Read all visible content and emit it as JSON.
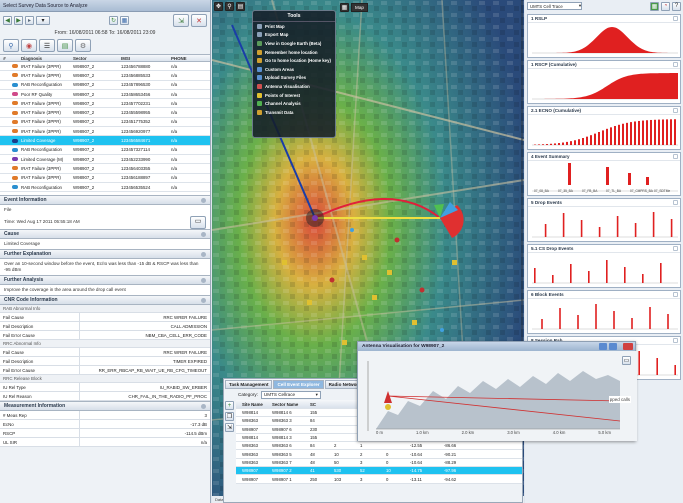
{
  "left_panel": {
    "title": "Select Survey Data Source to Analyze",
    "date_range": "From: 16/08/2011 06:58 To: 16/08/2011 23:09",
    "columns": [
      "#",
      "",
      "Diagnosis",
      "Sector",
      "IMSI",
      "PHONE"
    ],
    "rows": [
      {
        "n": "",
        "color": "#e07a2a",
        "diagnosis": "IRAT Failure (3PPR)",
        "sector": "W98907_2",
        "imsi": "123456788880",
        "phone": "n/a"
      },
      {
        "n": "",
        "color": "#e07a2a",
        "diagnosis": "IRAT Failure (3PPR)",
        "sector": "W98907_2",
        "imsi": "123456885533",
        "phone": "n/a"
      },
      {
        "n": "",
        "color": "#2a8fd0",
        "diagnosis": "RAB Reconfiguration",
        "sector": "W98907_2",
        "imsi": "123457896530",
        "phone": "n/a"
      },
      {
        "n": "",
        "color": "#d04a8a",
        "diagnosis": "Poor RF Quality",
        "sector": "W98907_2",
        "imsi": "123458653456",
        "phone": "n/a"
      },
      {
        "n": "",
        "color": "#e07a2a",
        "diagnosis": "IRAT Failure (3PPR)",
        "sector": "W98907_2",
        "imsi": "123457702231",
        "phone": "n/a"
      },
      {
        "n": "",
        "color": "#e07a2a",
        "diagnosis": "IRAT Failure (3PPR)",
        "sector": "W98907_2",
        "imsi": "123455598955",
        "phone": "n/a"
      },
      {
        "n": "",
        "color": "#e07a2a",
        "diagnosis": "IRAT Failure (3PPR)",
        "sector": "W98907_2",
        "imsi": "123451775352",
        "phone": "n/a"
      },
      {
        "n": "",
        "color": "#e07a2a",
        "diagnosis": "IRAT Failure (3PPR)",
        "sector": "W98907_2",
        "imsi": "123456920977",
        "phone": "n/a"
      },
      {
        "n": "",
        "color": "#1a3d8a",
        "diagnosis": "Limited Coverage",
        "sector": "W98907_2",
        "imsi": "123456584671",
        "phone": "n/a",
        "selected": true
      },
      {
        "n": "",
        "color": "#2a8fd0",
        "diagnosis": "RAB Reconfiguration",
        "sector": "W98907_2",
        "imsi": "123457327114",
        "phone": "n/a"
      },
      {
        "n": "",
        "color": "#7a3ab0",
        "diagnosis": "Limited Coverage (M)",
        "sector": "W98907_2",
        "imsi": "123452233990",
        "phone": "n/a"
      },
      {
        "n": "",
        "color": "#e07a2a",
        "diagnosis": "IRAT Failure (3PPR)",
        "sector": "W98907_2",
        "imsi": "123456403355",
        "phone": "n/a"
      },
      {
        "n": "",
        "color": "#e07a2a",
        "diagnosis": "IRAT Failure (3PPR)",
        "sector": "W98907_2",
        "imsi": "123456188897",
        "phone": "n/a"
      },
      {
        "n": "",
        "color": "#2a8fd0",
        "diagnosis": "RAB Reconfiguration",
        "sector": "W98907_2",
        "imsi": "123456535524",
        "phone": "n/a"
      }
    ],
    "event_info_header": "Event Information",
    "file_label": "File",
    "time_label": "Time: Wed Aug 17 2011 05:55:18 AM",
    "cause_header": "Cause",
    "cause_value": "Limited Coverage",
    "further_expl_header": "Further Explanation",
    "further_expl_text": "Over an 10-second window before the event, Ec/Io was less than -15 dB & RSCP was less than -95 dBm",
    "further_analysis_header": "Further Analysis",
    "further_analysis_text": "Improve the coverage in the area around the drop call event",
    "cnr_header": "CNR Code Information",
    "rab_header": "RAB Abnormal Info",
    "rab_rows": [
      {
        "k": "Fail Cause",
        "v": "RRC WRER FAILURE"
      },
      {
        "k": "Fail Description",
        "v": "CALL ADMISSION"
      },
      {
        "k": "Fail Error Cause",
        "v": "NBM_CBA_CELL_ERR_CODE"
      }
    ],
    "rrc_header": "RRC Abnormal Info",
    "rrc_rows": [
      {
        "k": "Fail Cause",
        "v": "RRC WRER FAILURE"
      },
      {
        "k": "Fail Description",
        "v": "TIMER EXPIRED"
      },
      {
        "k": "Fail Error Cause",
        "v": "RR_ERR_RBCAP_RB_WAIT_UE_RB_CFG_TIMEOUT"
      }
    ],
    "release_header": "RRC Release Block",
    "release_rows": [
      {
        "k": "IU Rel Type",
        "v": "IU_RABID_SW_ERBER"
      },
      {
        "k": "IU Rel Reason",
        "v": "CHR_FAIL_IN_THE_RADIO_PF_PROC"
      }
    ],
    "meas_header": "Measurement Information",
    "meas_rows": [
      {
        "k": "# Meas Rep",
        "v": "3"
      },
      {
        "k": "EcNo",
        "v": "-17.3 dB"
      },
      {
        "k": "RSCP",
        "v": "-114.5 dBm"
      },
      {
        "k": "UL SIR",
        "v": "n/a"
      }
    ]
  },
  "map": {
    "top_label": "Map",
    "tools_title": "Tools",
    "tools": [
      {
        "label": "Print Map",
        "color": "#8aa0b8"
      },
      {
        "label": "Export Map",
        "color": "#8aa0b8"
      },
      {
        "label": "View in Google Earth (Beta)",
        "color": "#5a9a5a"
      },
      {
        "label": "Remember home location",
        "color": "#d0a030"
      },
      {
        "label": "Go to home location (Home key)",
        "color": "#d0a030"
      },
      {
        "label": "Custom Areas",
        "color": "#5a90d0"
      },
      {
        "label": "Upload Survey Files",
        "color": "#5a90d0"
      },
      {
        "label": "Antenna Visualisation",
        "color": "#d05050"
      },
      {
        "label": "Points of Interest",
        "color": "#e0c030"
      },
      {
        "label": "Channel Analysis",
        "color": "#50b050"
      },
      {
        "label": "Transmit Data",
        "color": "#d0a030"
      }
    ],
    "status": "Data location: lat: 9.18147, lng: 263.09098 and lat: 9.14886, lng: 261.08845"
  },
  "right_panel": {
    "dropdown": "UMTS Cell Trace",
    "charts": [
      {
        "title": "1 RSLP"
      },
      {
        "title": "1 RSCP (Cumulative)"
      },
      {
        "title": "2.1 ECNO (Cumulative)"
      },
      {
        "title": "4 Event Summary"
      },
      {
        "title": "5 Drop Events"
      },
      {
        "title": "5.1 CS Drop Events"
      },
      {
        "title": "6 Block Events"
      },
      {
        "title": "8 Session Rab"
      }
    ],
    "event_summary_ticks": [
      "07_08_BA",
      "07_35_BA",
      "07_FB_BA",
      "07_TL_BA",
      "07_CMPRS_BA",
      "07_SDTMe"
    ]
  },
  "bottom_table": {
    "tabs": [
      "Task Management",
      "Cell Event Explorer",
      "Radio Network"
    ],
    "category_label": "Category:",
    "category_value": "UMTS Cellrace",
    "columns": [
      "",
      "Site Name",
      "Sector Name",
      "SC",
      "",
      "",
      "",
      "",
      ""
    ],
    "rows": [
      [
        "",
        "W98814",
        "W98814 6",
        "155",
        "",
        "",
        "",
        "",
        ""
      ],
      [
        "",
        "W98363",
        "W98363 3",
        "84",
        "",
        "",
        "",
        "",
        ""
      ],
      [
        "",
        "W98907",
        "W98907 6",
        "230",
        "",
        "",
        "",
        "",
        ""
      ],
      [
        "",
        "W98814",
        "W98814 3",
        "155",
        "",
        "",
        "",
        "",
        ""
      ],
      [
        "",
        "W98363",
        "W98363 6",
        "84",
        "2",
        "1",
        "",
        "-12.55",
        "-86.66"
      ],
      [
        "",
        "W98363",
        "W98363 5",
        "48",
        "10",
        "2",
        "0",
        "-10.64",
        "-90.21"
      ],
      [
        "",
        "W98363",
        "W98363 7",
        "48",
        "50",
        "3",
        "0",
        "-10.64",
        "-88.29"
      ],
      [
        "",
        "W98907",
        "W98907 2",
        "41",
        "530",
        "52",
        "10",
        "-14.75",
        "-97.96"
      ],
      [
        "",
        "W98907",
        "W98907 1",
        "250",
        "103",
        "3",
        "0",
        "-13.11",
        "-94.62"
      ]
    ],
    "selected_row": 7
  },
  "antenna_window": {
    "title": "Antenna Visualisation for W98907_2",
    "ticks": [
      "0 m",
      "1.0 km",
      "2.0 km",
      "3.0 km",
      "4.0 km",
      "5.0 km"
    ],
    "right_label": "pped calls"
  }
}
